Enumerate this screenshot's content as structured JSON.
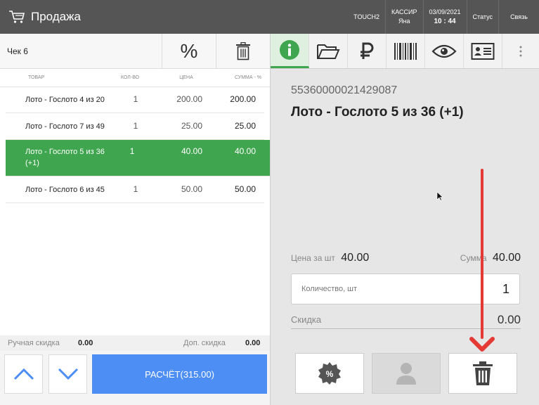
{
  "header": {
    "title": "Продажа",
    "terminal": "TOUCH2",
    "cashier_label": "КАССИР",
    "cashier_name": "Яна",
    "date": "03/09/2021",
    "time": "10 : 44",
    "status_label": "Статус",
    "connection_label": "Связь"
  },
  "receipt": {
    "label": "Чек 6",
    "columns": [
      "ТОВАР",
      "КОЛ-ВО",
      "ЦЕНА",
      "СУММА - %"
    ],
    "rows": [
      {
        "name": "Лото - Гослото 4 из 20",
        "qty": "1",
        "price": "200.00",
        "sum": "200.00"
      },
      {
        "name": "Лото - Гослото 7 из 49",
        "qty": "1",
        "price": "25.00",
        "sum": "25.00"
      },
      {
        "name": "Лото - Гослото 5 из 36 (+1)",
        "qty": "1",
        "price": "40.00",
        "sum": "40.00"
      },
      {
        "name": "Лото - Гослото 6 из 45",
        "qty": "1",
        "price": "50.00",
        "sum": "50.00"
      }
    ],
    "selected_index": 2,
    "manual_discount_label": "Ручная скидка",
    "manual_discount_value": "0.00",
    "extra_discount_label": "Доп. скидка",
    "extra_discount_value": "0.00",
    "payment_label": "РАСЧЁТ(315.00)"
  },
  "detail": {
    "barcode": "55360000021429087",
    "product_title": "Лото - Гослото 5 из 36 (+1)",
    "unit_price_label": "Цена за шт",
    "unit_price_value": "40.00",
    "sum_label": "Сумма",
    "sum_value": "40.00",
    "qty_label": "Количество, шт",
    "qty_value": "1",
    "discount_label": "Скидка",
    "discount_value": "0.00"
  },
  "colors": {
    "accent_green": "#3fa64f",
    "pay_blue": "#4d8ef5",
    "annotation_red": "#e53935"
  }
}
